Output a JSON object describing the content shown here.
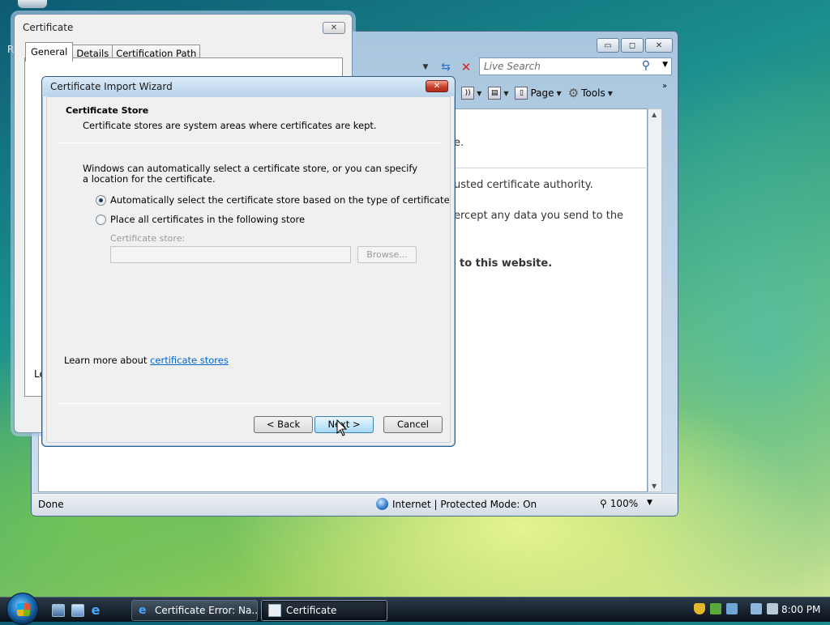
{
  "desktop": {
    "partial_icon_label": "R"
  },
  "ie": {
    "caption": {
      "minimize": "▭",
      "maximize": "◻",
      "close": "✕"
    },
    "search": {
      "placeholder": "Live Search"
    },
    "toolbar": {
      "page": "Page",
      "tools": "Tools"
    },
    "content": {
      "line1": "e.",
      "line2": "usted certificate authority.",
      "line3": "ercept any data you send to the",
      "line4": "to this website."
    },
    "status": {
      "done": "Done",
      "zone": "Internet | Protected Mode: On",
      "zoom": "100%"
    }
  },
  "certificate": {
    "title": "Certificate",
    "tabs": [
      "General",
      "Details",
      "Certification Path"
    ],
    "partial_text": "Le"
  },
  "wizard": {
    "title": "Certificate Import Wizard",
    "heading": "Certificate Store",
    "subheading": "Certificate stores are system areas where certificates are kept.",
    "intro": "Windows can automatically select a certificate store, or you can specify a location for the certificate.",
    "option_auto": "Automatically select the certificate store based on the type of certificate",
    "option_manual": "Place all certificates in the following store",
    "store_label": "Certificate store:",
    "store_value": "",
    "browse": "Browse...",
    "learn_prefix": "Learn more about ",
    "learn_link": "certificate stores",
    "back": "< Back",
    "next": "Next >",
    "cancel": "Cancel"
  },
  "taskbar": {
    "tasks": [
      {
        "label": "Certificate Error: Na...",
        "icon": "ie-icon"
      },
      {
        "label": "Certificate",
        "icon": "certificate-icon"
      }
    ],
    "clock": "8:00 PM"
  }
}
